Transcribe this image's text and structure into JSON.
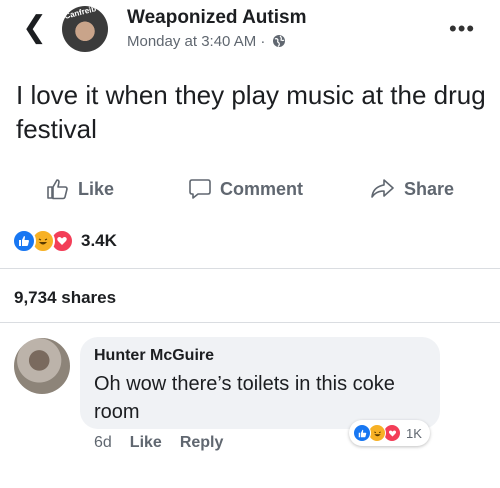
{
  "post": {
    "author": "Weaponized Autism",
    "avatar_tag": "Canfreib",
    "time": "Monday at 3:40 AM ·",
    "text": "I love it when they play music at the drug festival",
    "reaction_count": "3.4K",
    "shares": "9,734 shares"
  },
  "actions": {
    "like": "Like",
    "comment": "Comment",
    "share": "Share"
  },
  "comment": {
    "author": "Hunter McGuire",
    "text": "Oh wow there’s toilets in this coke room",
    "age": "6d",
    "like": "Like",
    "reply": "Reply",
    "reaction_count": "1K"
  },
  "icons": {
    "back": "chevron-left-icon",
    "globe": "globe-icon",
    "more": "more-icon",
    "like": "thumbs-up-icon",
    "comment": "speech-bubble-icon",
    "share": "share-arrow-icon",
    "reactions": [
      "like-reaction-icon",
      "haha-reaction-icon",
      "love-reaction-icon"
    ]
  },
  "colors": {
    "like_blue": "#1877f2",
    "haha_yellow": "#f7b125",
    "love_red": "#f33e58",
    "secondary_text": "#606770",
    "bubble_bg": "#f0f2f5"
  }
}
